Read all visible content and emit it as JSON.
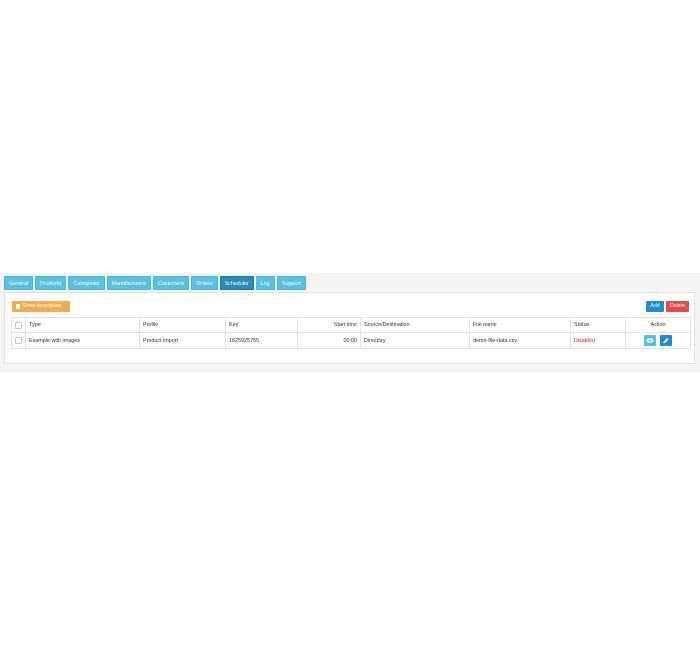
{
  "tabs": [
    {
      "label": "General"
    },
    {
      "label": "Products"
    },
    {
      "label": "Categories"
    },
    {
      "label": "Manufacturers"
    },
    {
      "label": "Customers"
    },
    {
      "label": "Orders"
    },
    {
      "label": "Scheduler",
      "active": true
    },
    {
      "label": "Log"
    },
    {
      "label": "Support"
    }
  ],
  "toolbar": {
    "show_description_label": "Show description",
    "add_label": "Add",
    "delete_label": "Delete"
  },
  "table": {
    "columns": {
      "type": "Type",
      "profile": "Profile",
      "key": "Key",
      "start_time": "Start time",
      "source_destination": "Source/Destination",
      "file_name": "File name",
      "status": "Status",
      "action": "Action"
    },
    "rows": [
      {
        "type": "Example with images",
        "profile": "Product import",
        "key": "1625925755",
        "start_time": "00:00",
        "source_destination": "Directory",
        "file_name": "demo-file-data.csv",
        "status": "Disabled"
      }
    ]
  },
  "colors": {
    "tab": "#5bc0de",
    "tab_active": "#2a8bb5",
    "warning": "#f0ad4e",
    "primary": "#1f8cd6",
    "danger": "#e04b4b",
    "status_disabled": "#e02020"
  },
  "icons": {
    "show_description": "document-icon",
    "view": "eye-icon",
    "edit": "pencil-icon"
  }
}
